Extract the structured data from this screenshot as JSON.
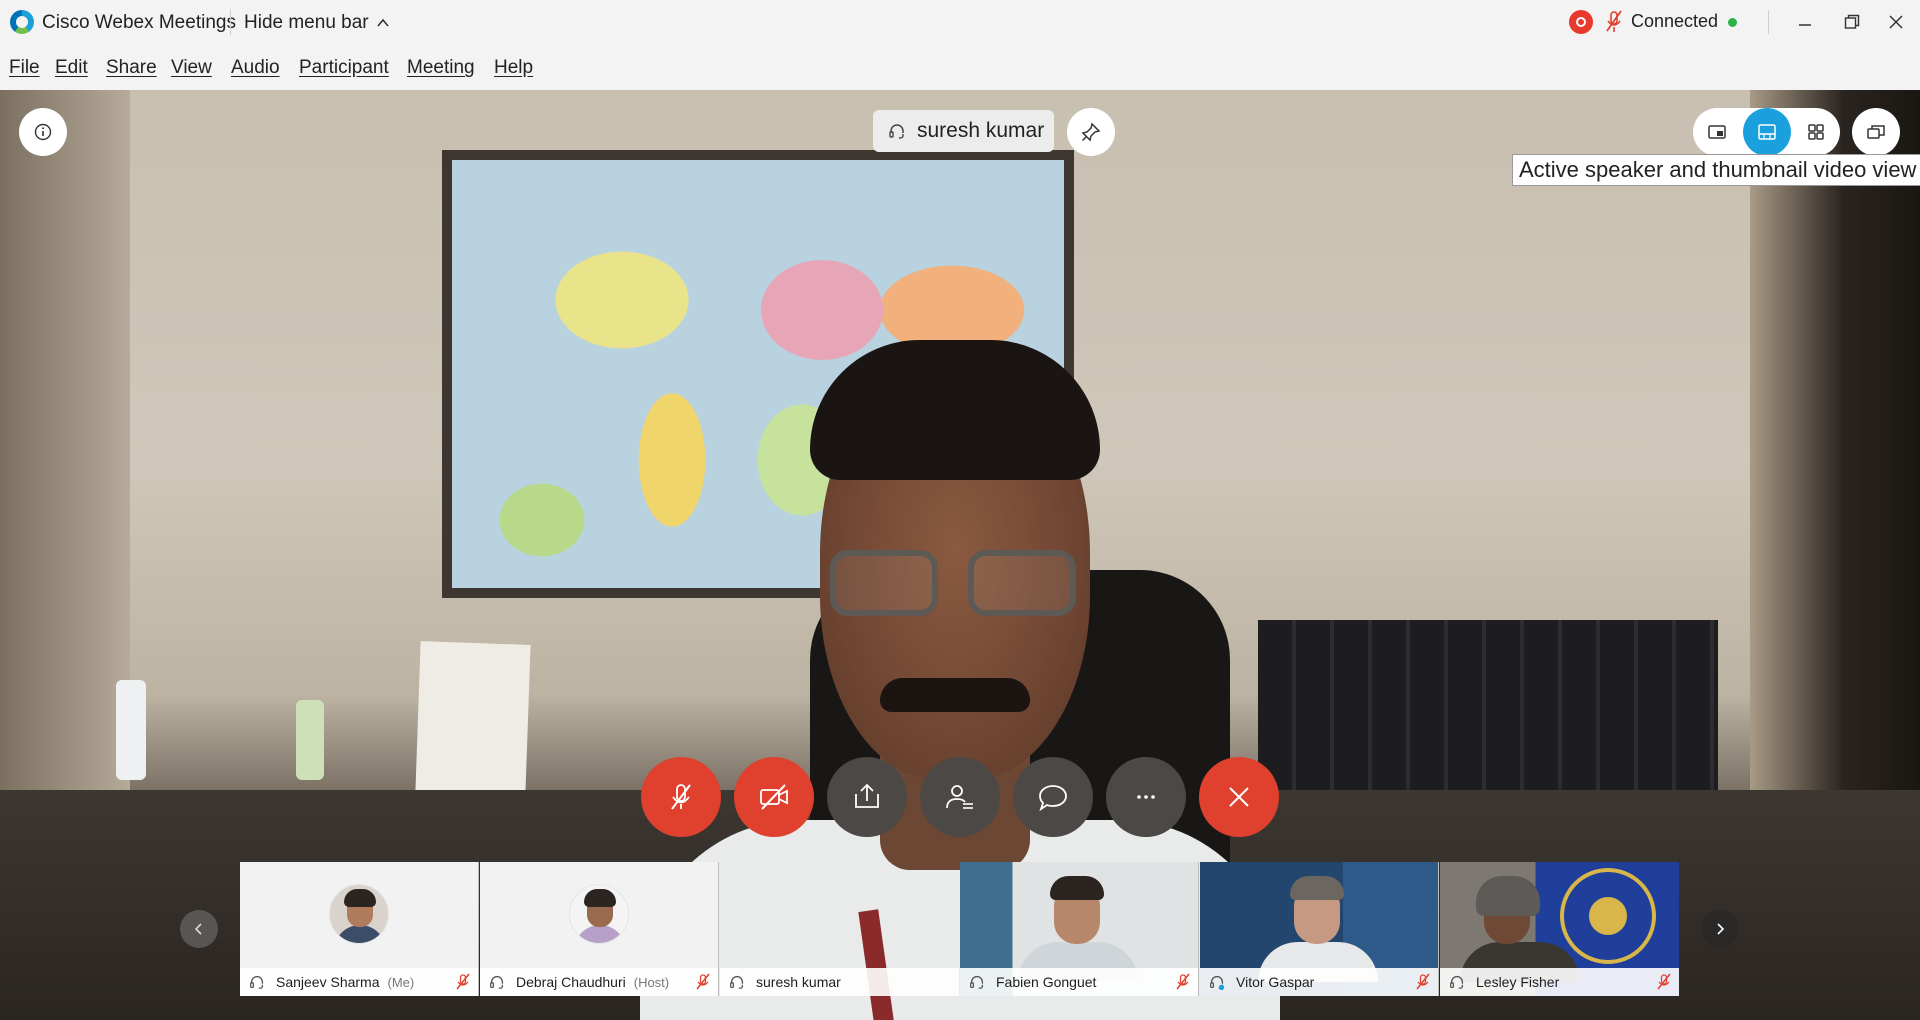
{
  "titlebar": {
    "app_title": "Cisco Webex Meetings",
    "hide_menu_label": "Hide menu bar",
    "connection_status": "Connected"
  },
  "menu": {
    "items": [
      "File",
      "Edit",
      "Share",
      "View",
      "Audio",
      "Participant",
      "Meeting",
      "Help"
    ]
  },
  "stage": {
    "active_speaker": "suresh kumar",
    "tooltip": "Active speaker and thumbnail video view",
    "layout_views": [
      "picture-in-picture-icon",
      "speaker-thumbnail-icon",
      "grid-icon"
    ],
    "active_layout": "speaker-thumbnail-icon"
  },
  "controls": [
    {
      "id": "mute",
      "icon": "mic-off-icon",
      "color": "#e0412f"
    },
    {
      "id": "video",
      "icon": "video-off-icon",
      "color": "#e0412f"
    },
    {
      "id": "share",
      "icon": "share-icon",
      "color": "#4b4846"
    },
    {
      "id": "participants",
      "icon": "participants-icon",
      "color": "#4b4846"
    },
    {
      "id": "chat",
      "icon": "chat-icon",
      "color": "#4b4846"
    },
    {
      "id": "more",
      "icon": "more-icon",
      "color": "#4b4846"
    },
    {
      "id": "leave",
      "icon": "close-icon",
      "color": "#e0412f"
    }
  ],
  "participants": [
    {
      "name": "Sanjeev Sharma",
      "role": "(Me)",
      "muted": true,
      "type": "avatar"
    },
    {
      "name": "Debraj Chaudhuri",
      "role": "(Host)",
      "muted": true,
      "type": "avatar"
    },
    {
      "name": "suresh kumar",
      "role": "",
      "muted": false,
      "type": "transparent"
    },
    {
      "name": "Fabien Gonguet",
      "role": "",
      "muted": true,
      "type": "video"
    },
    {
      "name": "Vitor Gaspar",
      "role": "",
      "muted": true,
      "type": "video"
    },
    {
      "name": "Lesley Fisher",
      "role": "",
      "muted": true,
      "type": "video"
    }
  ],
  "colors": {
    "accent": "#1aa0dc",
    "danger": "#e0412f",
    "control_dark": "#4b4846",
    "connected": "#29b34a"
  }
}
